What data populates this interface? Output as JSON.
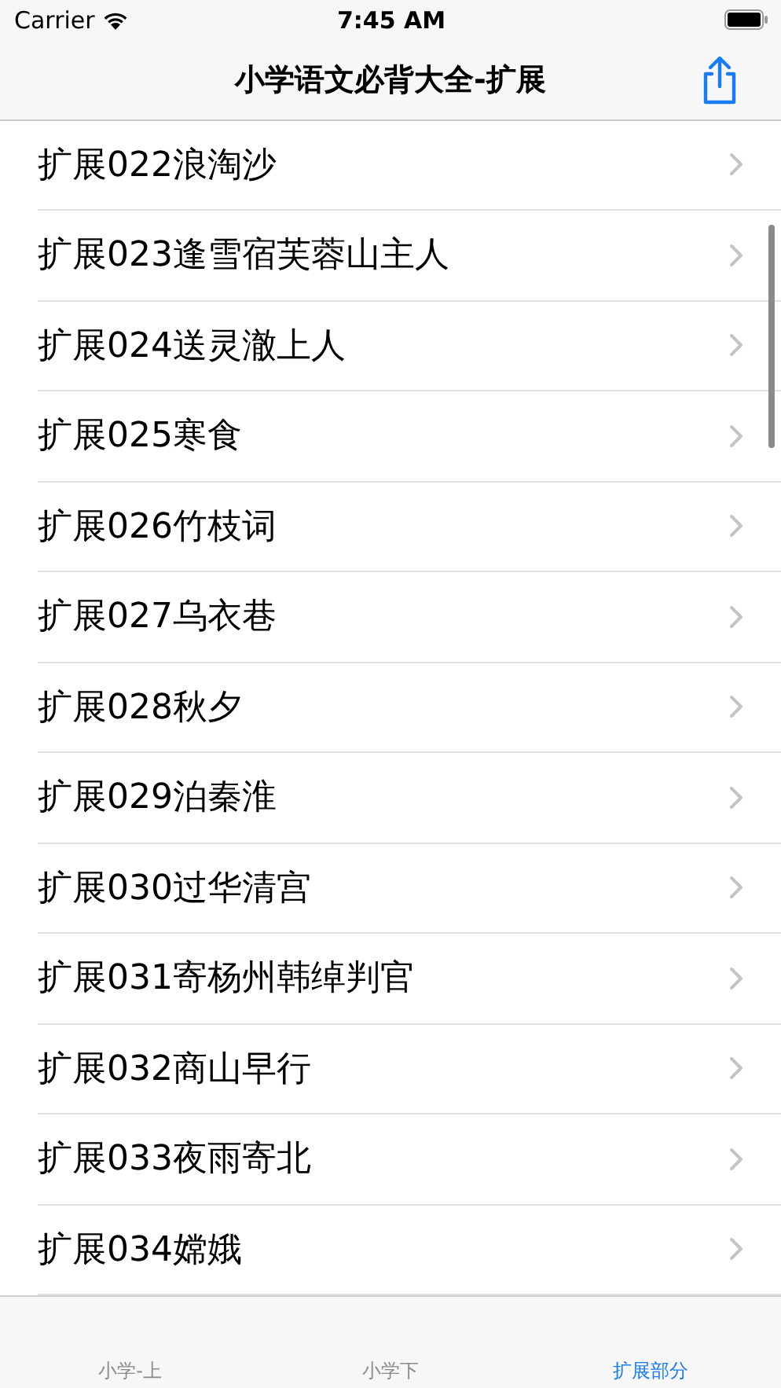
{
  "status_bar": {
    "carrier": "Carrier",
    "time": "7:45 AM"
  },
  "nav": {
    "title": "小学语文必背大全-扩展"
  },
  "list": [
    {
      "title": "扩展022浪淘沙"
    },
    {
      "title": "扩展023逢雪宿芙蓉山主人"
    },
    {
      "title": "扩展024送灵澈上人"
    },
    {
      "title": "扩展025寒食"
    },
    {
      "title": "扩展026竹枝词"
    },
    {
      "title": "扩展027乌衣巷"
    },
    {
      "title": "扩展028秋夕"
    },
    {
      "title": "扩展029泊秦淮"
    },
    {
      "title": "扩展030过华清宫"
    },
    {
      "title": "扩展031寄杨州韩绰判官"
    },
    {
      "title": "扩展032商山早行"
    },
    {
      "title": "扩展033夜雨寄北"
    },
    {
      "title": "扩展034嫦娥"
    }
  ],
  "tabs": [
    {
      "label": "小学-上",
      "selected": false
    },
    {
      "label": "小学下",
      "selected": false
    },
    {
      "label": "扩展部分",
      "selected": true
    }
  ]
}
